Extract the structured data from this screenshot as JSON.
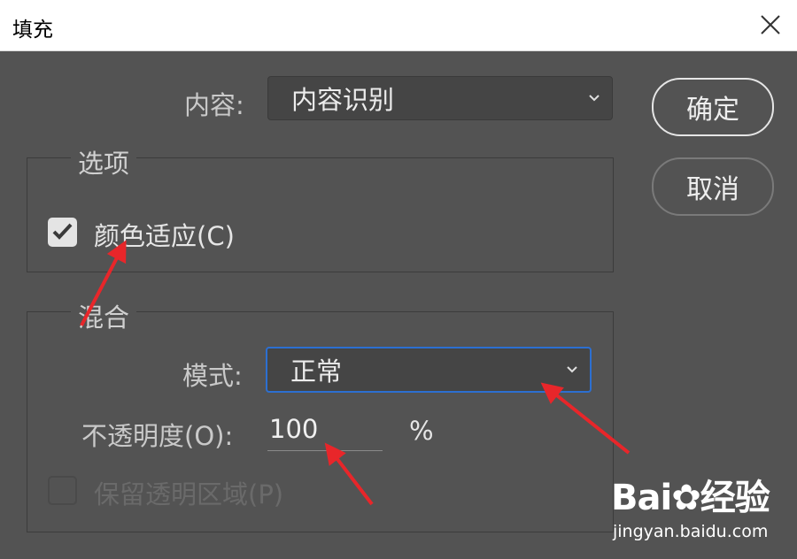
{
  "window": {
    "title": "填充"
  },
  "content": {
    "label": "内容:",
    "selected": "内容识别"
  },
  "buttons": {
    "ok": "确定",
    "cancel": "取消"
  },
  "options_group": {
    "legend": "选项",
    "color_adapt": {
      "label": "颜色适应(C)",
      "checked": true
    }
  },
  "blend_group": {
    "legend": "混合",
    "mode": {
      "label": "模式:",
      "selected": "正常"
    },
    "opacity": {
      "label": "不透明度(O):",
      "value": "100",
      "unit": "%"
    },
    "preserve_transparency": {
      "label": "保留透明区域(P)",
      "checked": false,
      "disabled": true
    }
  },
  "watermark": {
    "logo": "Bai",
    "logo_suffix": "经验",
    "url": "jingyan.baidu.com"
  },
  "colors": {
    "annotation_arrow": "#e8262a",
    "focus_border": "#2c6fd1",
    "panel_bg": "#535353"
  }
}
